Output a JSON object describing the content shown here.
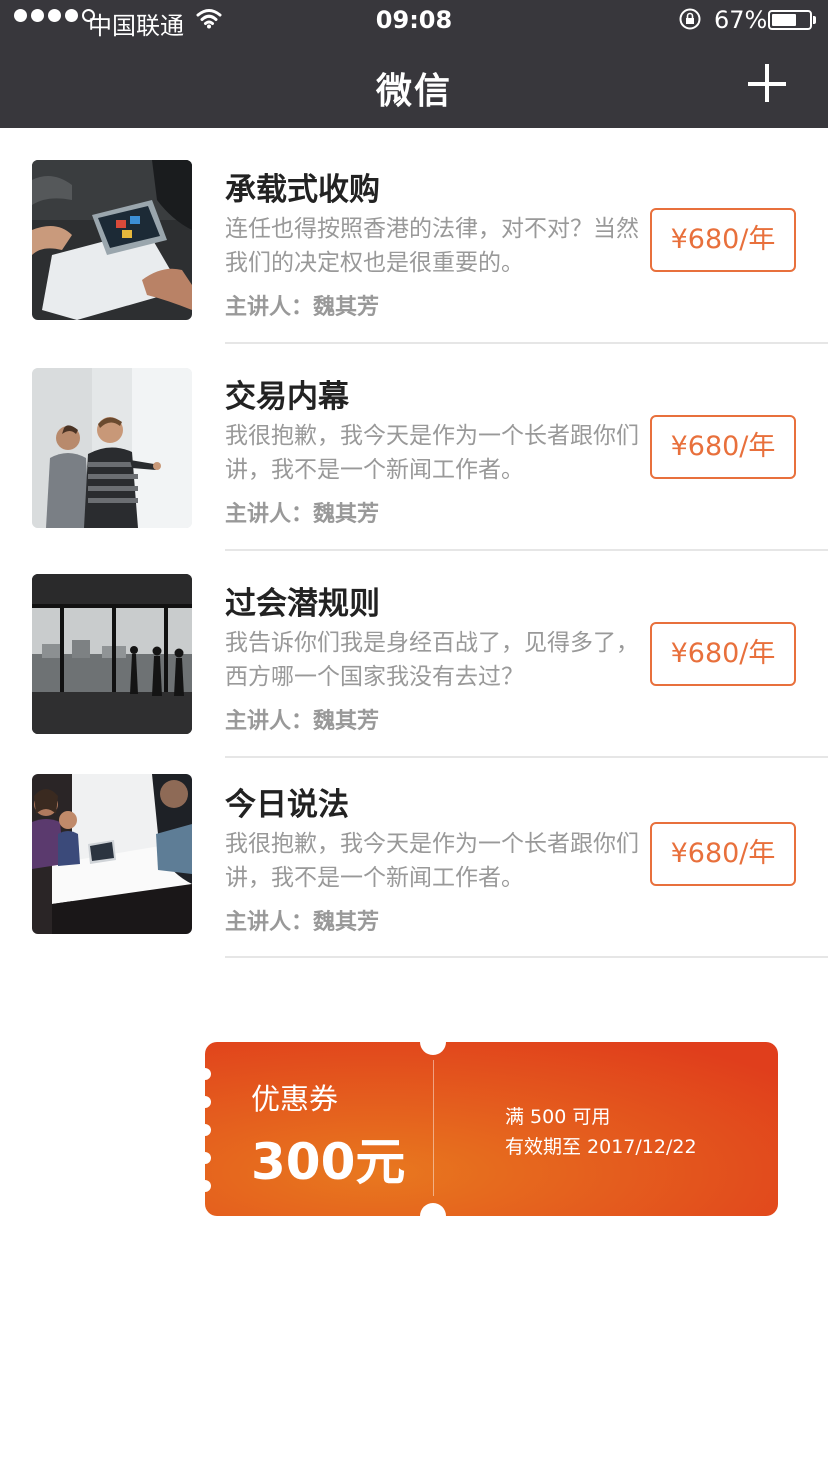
{
  "status_bar": {
    "carrier": "中国联通",
    "time": "09:08",
    "battery": "67%",
    "battery_level": 0.67
  },
  "nav": {
    "title": "微信",
    "add_icon": "plus-icon"
  },
  "courses": [
    {
      "title": "承载式收购",
      "description": "连任也得按照香港的法律，对不对？当然我们的决定权也是很重要的。",
      "speaker": "主讲人：魏其芳",
      "price": "¥680/年",
      "image": "meeting-laptop-photo"
    },
    {
      "title": "交易内幕",
      "description": "我很抱歉，我今天是作为一个长者跟你们讲，我不是一个新闻工作者。",
      "speaker": "主讲人：魏其芳",
      "price": "¥680/年",
      "image": "whiteboard-men-photo"
    },
    {
      "title": "过会潜规则",
      "description": "我告诉你们我是身经百战了，见得多了，西方哪一个国家我没有去过？",
      "speaker": "主讲人：魏其芳",
      "price": "¥680/年",
      "image": "office-window-photo"
    },
    {
      "title": "今日说法",
      "description": "我很抱歉，我今天是作为一个长者跟你们讲，我不是一个新闻工作者。",
      "speaker": "主讲人：魏其芳",
      "price": "¥680/年",
      "image": "conference-table-photo"
    }
  ],
  "coupon": {
    "label": "优惠券",
    "amount": "300元",
    "condition": "满 500 可用",
    "expiry": "有效期至 2017/12/22"
  },
  "colors": {
    "navbar": "#38373c",
    "accent": "#e8703c",
    "coupon_start": "#e8781f",
    "coupon_end": "#e03e1c"
  }
}
